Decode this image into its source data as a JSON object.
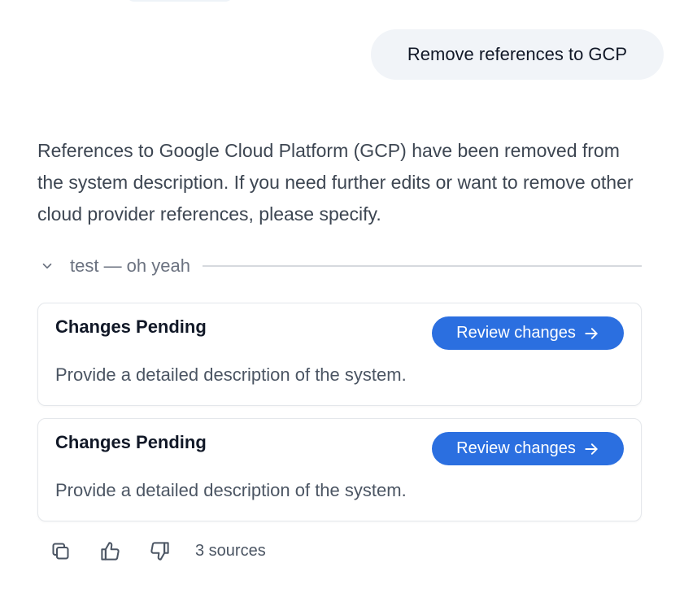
{
  "conversation": {
    "user_message": "Remove references to GCP",
    "assistant_message": "References to Google Cloud Platform (GCP) have been removed from the system description. If you need further edits or want to remove other cloud provider references, please specify.",
    "collapsible": {
      "label": "test — oh yeah",
      "icon": "chevron-down-icon"
    },
    "change_cards": [
      {
        "title": "Changes Pending",
        "button_label": "Review changes",
        "button_icon": "arrow-right-icon",
        "description": "Provide a detailed description of the system."
      },
      {
        "title": "Changes Pending",
        "button_label": "Review changes",
        "button_icon": "arrow-right-icon",
        "description": "Provide a detailed description of the system."
      }
    ],
    "actions": {
      "copy_icon": "copy-icon",
      "thumbs_up_icon": "thumbs-up-icon",
      "thumbs_down_icon": "thumbs-down-icon",
      "sources_label": "3 sources"
    }
  },
  "colors": {
    "user_bubble": "#f1f4f8",
    "accent": "#2b6fe0",
    "card_border": "#e4e7eb",
    "divider": "#d6d9de"
  }
}
